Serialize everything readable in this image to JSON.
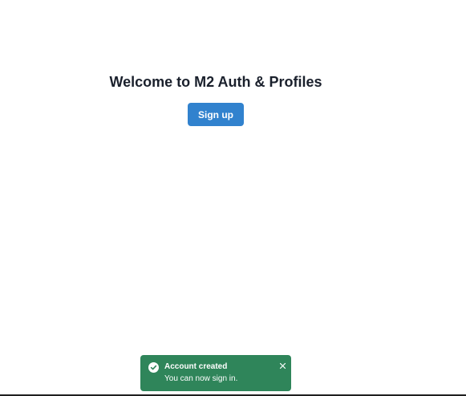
{
  "main": {
    "title": "Welcome to M2 Auth & Profiles",
    "signup_label": "Sign up"
  },
  "toast": {
    "title": "Account created",
    "description": "You can now sign in.",
    "status": "success",
    "icon": "check-circle-icon",
    "close_icon": "close-icon",
    "color": "#2f855a"
  },
  "colors": {
    "primary_button": "#3182ce",
    "heading": "#1a202c",
    "background": "#ffffff"
  }
}
